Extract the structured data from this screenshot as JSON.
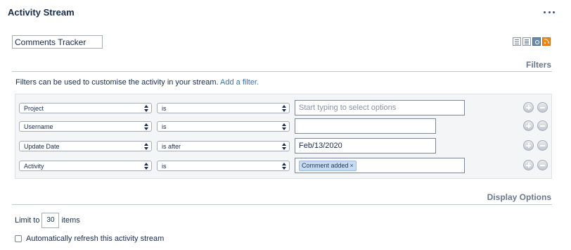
{
  "gadget": {
    "title": "Activity Stream",
    "menu_icon": "more-horizontal-icon"
  },
  "stream_title": {
    "value": "Comments Tracker"
  },
  "view_icons": [
    "full-view-icon",
    "list-view-icon",
    "settings-icon",
    "rss-feed-icon"
  ],
  "filters": {
    "heading": "Filters",
    "description": "Filters can be used to customise the activity in your stream.",
    "add_link": "Add a filter.",
    "rows": [
      {
        "field": "Project",
        "operator": "is",
        "value": "",
        "placeholder": "Start typing to select options"
      },
      {
        "field": "Username",
        "operator": "is",
        "value": ""
      },
      {
        "field": "Update Date",
        "operator": "is after",
        "value": "Feb/13/2020"
      },
      {
        "field": "Activity",
        "operator": "is",
        "chip": "Comment added",
        "chip_remove": "×"
      }
    ]
  },
  "display_options": {
    "heading": "Display Options",
    "limit_prefix": "Limit to",
    "limit_value": "30",
    "limit_suffix": "items",
    "auto_refresh_label": "Automatically refresh this activity stream",
    "auto_refresh_checked": false
  }
}
